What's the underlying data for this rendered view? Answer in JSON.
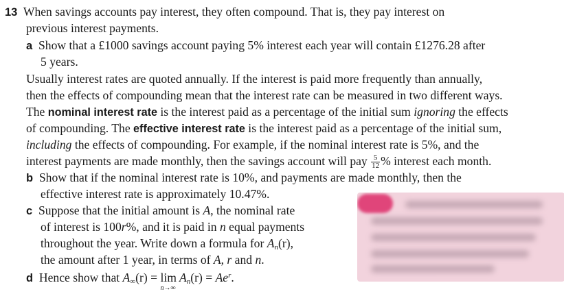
{
  "question_number": "13",
  "intro": [
    "When savings accounts pay interest, they often compound. That is, they pay interest on",
    "previous interest payments."
  ],
  "part_a": {
    "label": "a",
    "lines": [
      "Show that a £1000 savings account paying 5% interest each year will contain £1276.28 after",
      "5 years."
    ]
  },
  "para": {
    "l1": "Usually interest rates are quoted annually. If the interest is paid more frequently than annually,",
    "l2": "then the effects of compounding mean that the interest rate can be measured in two different ways.",
    "l3_pre": "The ",
    "l3_term": "nominal interest rate",
    "l3_mid": " is the interest paid as a percentage of the initial sum ",
    "l3_em": "ignoring",
    "l3_post": " the effects",
    "l4_pre": "of compounding. The ",
    "l4_term": "effective interest rate",
    "l4_post": " is the interest paid as a percentage of the initial sum,",
    "l5_em": "including",
    "l5_post": " the effects of compounding. For example, if the nominal interest rate is 5%, and the",
    "l6_pre": "interest payments are made monthly, then the savings account will pay ",
    "l6_frac_num": "5",
    "l6_frac_den": "12",
    "l6_post": "% interest each month."
  },
  "part_b": {
    "label": "b",
    "lines": [
      "Show that if the nominal interest rate is 10%, and payments are made monthly, then the",
      "effective interest rate is approximately 10.47%."
    ]
  },
  "part_c": {
    "label": "c",
    "l1_pre": "Suppose that the initial amount is ",
    "l1_A": "A",
    "l1_post": ", the nominal rate",
    "l2_pre": "of interest is 100",
    "l2_r": "r",
    "l2_post": "%, and it is paid in ",
    "l2_n": "n",
    "l2_end": " equal payments",
    "l3_pre": "throughout the year. Write down a formula for ",
    "l3_A": "A",
    "l3_sub": "n",
    "l3_arg": "(r)",
    "l3_end": ",",
    "l4_pre": "the amount after 1 year, in terms of ",
    "l4_A": "A",
    "l4_c1": ", ",
    "l4_r": "r",
    "l4_and": " and ",
    "l4_n": "n",
    "l4_end": "."
  },
  "part_d": {
    "label": "d",
    "pre": "Hence show that ",
    "A1": "A",
    "sub1": "∞",
    "arg1": "(r)",
    "eq1": " = ",
    "lim": "lim",
    "lim_under": "n→∞",
    "A2": " A",
    "sub2": "n",
    "arg2": "(r)",
    "eq2": " = ",
    "Ae": "Ae",
    "sup": "r",
    "end": "."
  }
}
